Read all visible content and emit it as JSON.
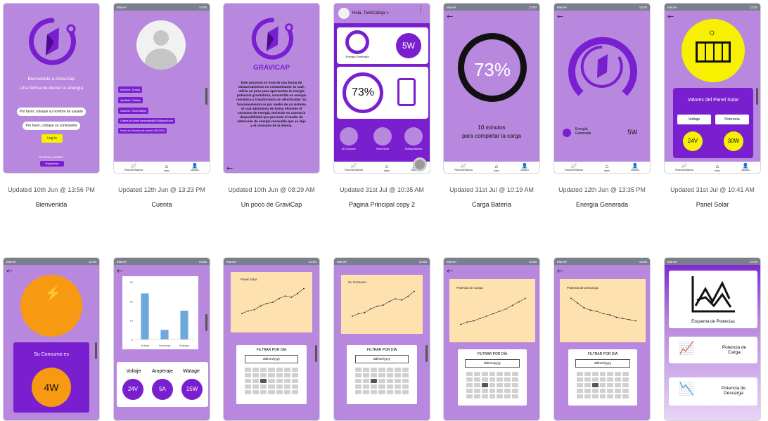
{
  "status": {
    "carrier": "Marvel",
    "time": "13:00"
  },
  "nav": {
    "bateria": "Potencia Batería",
    "inicio": "Inicio",
    "usuario": "Usuario"
  },
  "cards": [
    {
      "name": "Bienvenida",
      "updated": "Updated 10th Jun @ 13:56 PM"
    },
    {
      "name": "Cuenta",
      "updated": "Updated 12th Jun @ 13:23 PM"
    },
    {
      "name": "Un poco de GraviCap",
      "updated": "Updated 10th Jun @ 08:29 AM"
    },
    {
      "name": "Pagina Principal copy 2",
      "updated": "Updated 31st Jul @ 10:35 AM"
    },
    {
      "name": "Carga Batería",
      "updated": "Updated 31st Jul @ 10:19 AM"
    },
    {
      "name": "Energía Generada",
      "updated": "Updated 12th Jun @ 13:35 PM"
    },
    {
      "name": "Panel Solar",
      "updated": "Updated 31st Jul @ 10:41 AM"
    }
  ],
  "bienvenida": {
    "welcome": "Bienvenido a GraviCap",
    "tagline": "Una forma de elevar tu energía",
    "user_ph": "Por favor, coloque su nombre de usuario",
    "pass_ph": "Por favor, coloque su contraseña",
    "login": "Log in",
    "no_account": "No tiene cuenta?",
    "register": "Registrese"
  },
  "cuenta": {
    "fields": [
      "Nombre: Tomas",
      "Apellido: Calleja",
      "Usuario: TomiCalleja",
      "Cuenta de Gmail: tomascalleja0109@gmail.com",
      "Fecha de Creación de cuenta: 9/12/2024"
    ]
  },
  "gravicap": {
    "brand": "GRAVICAP",
    "text": "Este proyecto se trata de una forma de almacenamiento no contaminante, la cual, utiliza un peso para aprovechar la energía potencial gravitatoria, convertida en energía mecánica y transformaria en electricidad. Su funcionamiento es por medio de un sistema el cual administra de forma eficiente el consumo de energía, teniendo en cuenta la disponibilidad que presente el medio de obtención de energía renovable que se elija y el consumo de la misma."
  },
  "principal": {
    "greeting": "Hola, TomiCalleja >",
    "energy_label": "Energía Generada",
    "power": "5W",
    "battery": "73%",
    "mi_consumo": "Mi Consumo",
    "panel_solar": "Panel Solar",
    "entrega_bateria": "Entrega Batería"
  },
  "carga": {
    "percent": "73%",
    "remaining": "10 minutos",
    "remaining2": "para completar la carga"
  },
  "energia": {
    "label": "Energía Generada",
    "value": "5W"
  },
  "panel": {
    "title": "Valores del Panel Solar",
    "voltaje": "Voltaje",
    "potencia": "Potencia",
    "v_val": "24V",
    "p_val": "30W"
  },
  "consumo": {
    "title": "Su Consumo es",
    "value": "4W"
  },
  "barras": {
    "labels": [
      "Voltaje",
      "Amperaje",
      "Watage"
    ],
    "values": [
      24,
      5,
      15
    ],
    "ylim": [
      0,
      30
    ],
    "ticks": [
      "30",
      "20",
      "10",
      "0"
    ],
    "bottom_labels": [
      "Voltaje",
      "Amperaje",
      "Watage"
    ],
    "bottom_values": [
      "24V",
      "5A",
      "15W"
    ]
  },
  "graficos": {
    "panel": "Panel Solar",
    "consumo": "Su Consumo",
    "carga": "Potencia de Carga",
    "descarga": "Potencia de Descarga",
    "filtrar": "FILTRAR POR DÍA",
    "date_ph": "dd/mm/yyyy",
    "trend_up": [
      2,
      3,
      3.5,
      5,
      6,
      6.5,
      8,
      9,
      8.5,
      10,
      12
    ],
    "trend_carga": [
      1,
      2,
      2.5,
      3.5,
      4.5,
      5.5,
      6.5,
      7.5,
      9,
      10.5,
      12
    ],
    "trend_descarga": [
      12,
      10,
      8,
      7,
      6.5,
      5.5,
      5,
      4,
      3.5,
      3,
      2.5
    ]
  },
  "esquema": {
    "title": "Esquema de Potencias",
    "carga": "Potencia de Carga",
    "descarga": "Potencia de Descarga"
  },
  "colors": {
    "lilac": "#b887de",
    "purple": "#7a1fd0",
    "yellow": "#f7f000",
    "orange": "#f79a12"
  }
}
